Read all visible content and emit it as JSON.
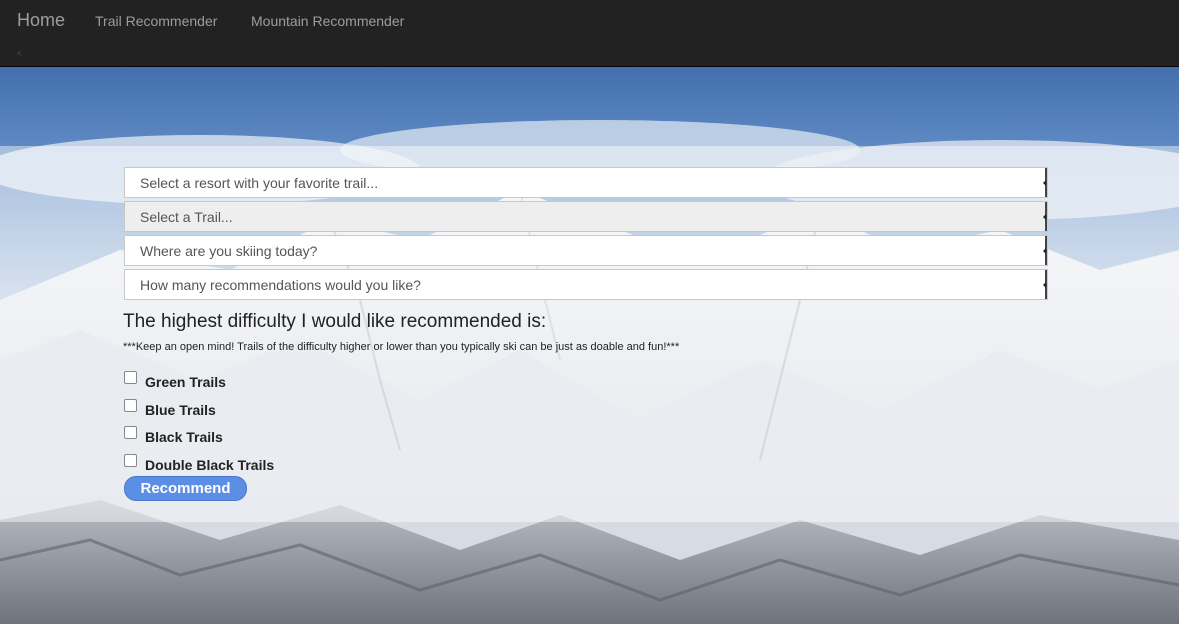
{
  "navbar": {
    "brand": "Home",
    "links": [
      "Trail Recommender",
      "Mountain Recommender"
    ],
    "small_mark": "<"
  },
  "form": {
    "selects": [
      {
        "placeholder": "Select a resort with your favorite trail...",
        "disabled": false
      },
      {
        "placeholder": "Select a Trail...",
        "disabled": true
      },
      {
        "placeholder": "Where are you skiing today?",
        "disabled": false
      },
      {
        "placeholder": "How many recommendations would you like?",
        "disabled": false
      }
    ],
    "heading": "The highest difficulty I would like recommended is:",
    "note": "***Keep an open mind! Trails of the difficulty higher or lower than you typically ski can be just as doable and fun!***",
    "checkboxes": [
      {
        "label": "Green Trails",
        "checked": false
      },
      {
        "label": "Blue Trails",
        "checked": false
      },
      {
        "label": "Black Trails",
        "checked": false
      },
      {
        "label": "Double Black Trails",
        "checked": false
      }
    ],
    "submit_label": "Recommend"
  },
  "colors": {
    "navbar_bg": "#222222",
    "nav_text": "#9d9d9d",
    "button_bg": "#5b8fe6"
  },
  "icons": {
    "select_arrow": "dropdown-arrow-icon"
  }
}
